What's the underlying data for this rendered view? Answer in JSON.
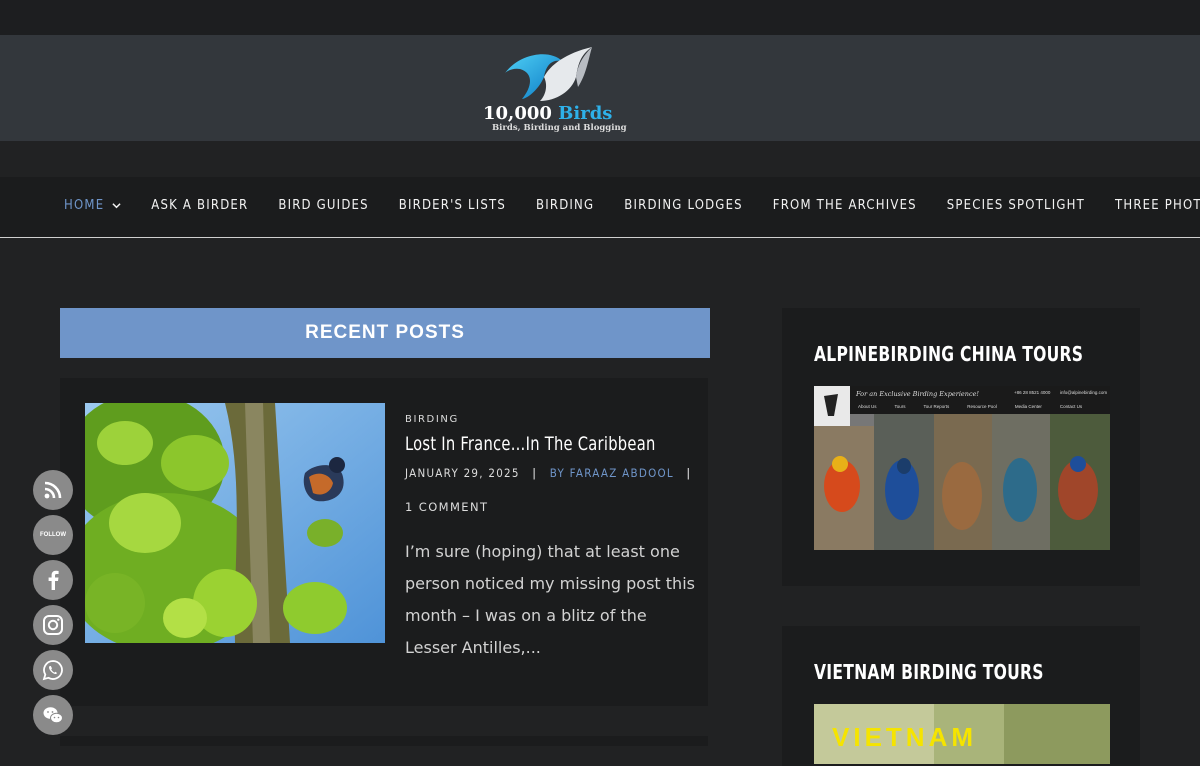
{
  "logo": {
    "brand_a": "10,000 ",
    "brand_b": "Birds",
    "tagline": "Birds, Birding and Blogging"
  },
  "nav": {
    "items": [
      {
        "label": "HOME",
        "active": true,
        "has_submenu": true
      },
      {
        "label": "ASK A BIRDER"
      },
      {
        "label": "BIRD GUIDES"
      },
      {
        "label": "BIRDER'S LISTS"
      },
      {
        "label": "BIRDING"
      },
      {
        "label": "BIRDING LODGES"
      },
      {
        "label": "FROM THE ARCHIVES"
      },
      {
        "label": "SPECIES SPOTLIGHT"
      },
      {
        "label": "THREE PHOTOS"
      }
    ]
  },
  "recent_posts": {
    "heading": "RECENT POSTS"
  },
  "post": {
    "category": "BIRDING",
    "title": "Lost In France…In The Caribbean",
    "date": "JANUARY 29, 2025",
    "author": "BY FARAAZ ABDOOL",
    "comments": "1 COMMENT",
    "excerpt": "I’m sure (hoping) that at least one person noticed my missing post this month – I was on a blitz of the Lesser Antilles,..."
  },
  "sidebar": {
    "widget1": {
      "title": "ALPINEBIRDING CHINA TOURS",
      "ad": {
        "tagline": "For an Exclusive Birding Experience!",
        "phone": "+86 28 8521 4000",
        "email": "info@alpinebirding.com",
        "menu": [
          "About Us",
          "Tours",
          "Tour Reports",
          "Resource Pool",
          "Media Center",
          "Contact Us"
        ]
      }
    },
    "widget2": {
      "title": "VIETNAM BIRDING TOURS",
      "banner_text": "VIETNAM"
    }
  },
  "social": {
    "buttons": [
      {
        "name": "rss-icon"
      },
      {
        "name": "follow-icon",
        "label": "FOLLOW"
      },
      {
        "name": "facebook-icon"
      },
      {
        "name": "instagram-icon"
      },
      {
        "name": "whatsapp-icon"
      },
      {
        "name": "wechat-icon"
      }
    ]
  },
  "colors": {
    "accent": "#6f95c9",
    "background": "#212223",
    "card": "#1b1c1d",
    "header": "#33373c",
    "logo_blue": "#2eb1ea"
  }
}
